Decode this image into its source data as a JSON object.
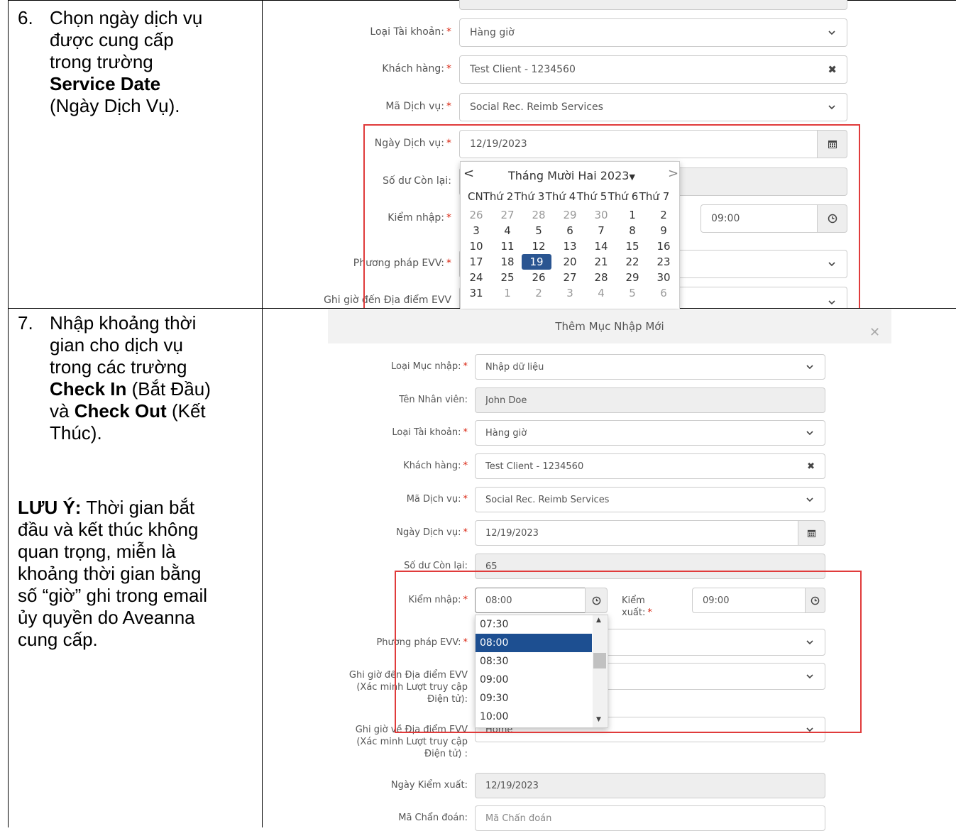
{
  "step6": {
    "number": "6.",
    "line1": "Chọn ngày dịch vụ",
    "line2": "được cung cấp",
    "line3": "trong trường",
    "bold": "Service Date",
    "line5": "(Ngày Dịch Vụ)."
  },
  "step7": {
    "number": "7.",
    "line1": "Nhập khoảng thời",
    "line2": "gian cho dịch vụ",
    "line3": "trong các trường",
    "bold1": "Check In",
    "rest1": " (Bắt Đầu)",
    "pre2": "và ",
    "bold2": "Check Out",
    "rest2": " (Kết",
    "line6": "Thúc)."
  },
  "note": {
    "label": "LƯU Ý:",
    "l1": " Thời gian bắt",
    "l2": "đầu và kết thúc không",
    "l3": "quan trọng, miễn là",
    "l4": "khoảng thời gian bằng",
    "l5": "số “giờ” ghi trong email",
    "l6": "ủy quyền do Aveanna",
    "l7": "cung cấp."
  },
  "form1": {
    "account_type_label": "Loại Tài khoản:",
    "account_type_value": "Hàng giờ",
    "client_label": "Khách hàng:",
    "client_value": "Test Client - 1234560",
    "service_code_label": "Mã Dịch vụ:",
    "service_code_value": "Social Rec. Reimb Services",
    "service_date_label": "Ngày Dịch vụ:",
    "service_date_value": "12/19/2023",
    "balance_label": "Số dư Còn lại:",
    "checkin_label": "Kiểm nhập:",
    "checkout_value": "09:00",
    "evv_method_label": "Phương pháp EVV:",
    "evv_arrival_label": "Ghi giờ đến Địa điểm EVV",
    "required_mark": "*"
  },
  "datepicker": {
    "month_title": "Tháng Mười Hai 2023",
    "prev": "<",
    "next": ">",
    "weekdays": [
      "CN",
      "Thứ 2",
      "Thứ 3",
      "Thứ 4",
      "Thứ 5",
      "Thứ 6",
      "Thứ 7"
    ],
    "weeks": [
      [
        "26",
        "27",
        "28",
        "29",
        "30",
        "1",
        "2"
      ],
      [
        "3",
        "4",
        "5",
        "6",
        "7",
        "8",
        "9"
      ],
      [
        "10",
        "11",
        "12",
        "13",
        "14",
        "15",
        "16"
      ],
      [
        "17",
        "18",
        "19",
        "20",
        "21",
        "22",
        "23"
      ],
      [
        "24",
        "25",
        "26",
        "27",
        "28",
        "29",
        "30"
      ],
      [
        "31",
        "1",
        "2",
        "3",
        "4",
        "5",
        "6"
      ]
    ],
    "selected": "19"
  },
  "form2": {
    "title": "Thêm Mục Nhập Mới",
    "entry_type_label": "Loại Mục nhập:",
    "entry_type_value": "Nhập dữ liệu",
    "employee_label": "Tên Nhân viên:",
    "employee_value": "John Doe",
    "account_type_label": "Loại Tài khoản:",
    "account_type_value": "Hàng giờ",
    "client_label": "Khách hàng:",
    "client_value": "Test Client - 1234560",
    "service_code_label": "Mã Dịch vụ:",
    "service_code_value": "Social Rec. Reimb Services",
    "service_date_label": "Ngày Dịch vụ:",
    "service_date_value": "12/19/2023",
    "balance_label": "Số dư Còn lại:",
    "balance_value": "65",
    "checkin_label": "Kiểm nhập:",
    "checkin_value": "08:00",
    "checkout_label_1": "Kiểm",
    "checkout_label_2": "xuất:",
    "checkout_value": "09:00",
    "evv_method_label": "Phương pháp EVV:",
    "evv_arrival_l1": "Ghi giờ đến Địa điểm EVV",
    "evv_arrival_l2": "(Xác minh Lượt truy cập",
    "evv_arrival_l3": "Điện tử):",
    "evv_return_l1": "Ghi giờ về Địa điểm EVV",
    "evv_return_l2": "(Xác minh Lượt truy cập",
    "evv_return_l3": "Điện tử) :",
    "evv_return_value": "Home",
    "checkout_date_label": "Ngày Kiểm xuất:",
    "checkout_date_value": "12/19/2023",
    "diag_label": "Mã Chẩn đoán:",
    "diag_placeholder": "Mã Chẩn đoán",
    "required_mark": "*",
    "time_options": [
      "07:30",
      "08:00",
      "08:30",
      "09:00",
      "09:30",
      "10:00"
    ],
    "time_selected": "08:00"
  },
  "colors": {
    "highlight_border": "#e03b3b",
    "selected_blue": "#1d4f91"
  }
}
